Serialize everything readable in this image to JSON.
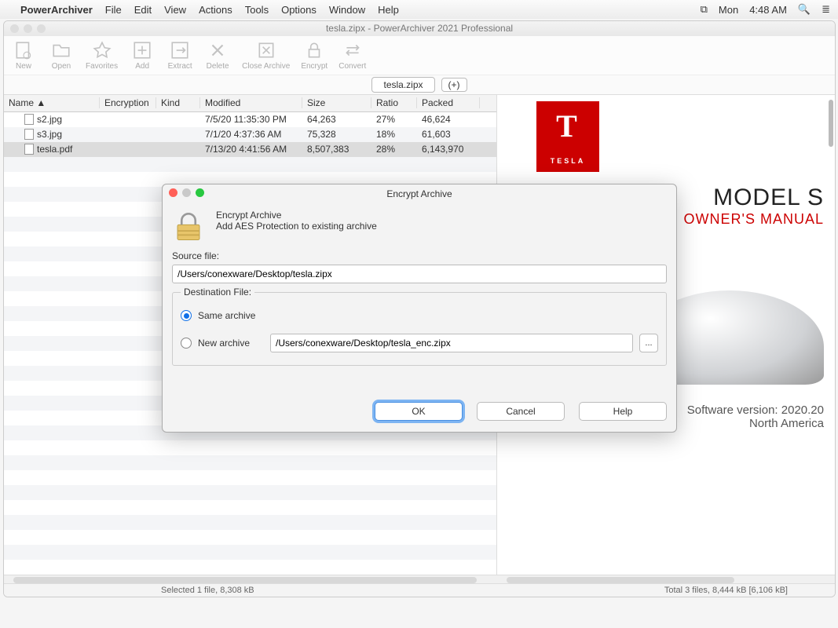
{
  "menubar": {
    "app": "PowerArchiver",
    "items": [
      "File",
      "Edit",
      "View",
      "Actions",
      "Tools",
      "Options",
      "Window",
      "Help"
    ],
    "clock_day": "Mon",
    "clock_time": "4:48 AM"
  },
  "window": {
    "title": "tesla.zipx - PowerArchiver 2021 Professional",
    "toolbar": [
      {
        "name": "new",
        "label": "New"
      },
      {
        "name": "open",
        "label": "Open"
      },
      {
        "name": "favorites",
        "label": "Favorites"
      },
      {
        "name": "add",
        "label": "Add"
      },
      {
        "name": "extract",
        "label": "Extract"
      },
      {
        "name": "delete",
        "label": "Delete"
      },
      {
        "name": "close-archive",
        "label": "Close Archive"
      },
      {
        "name": "encrypt",
        "label": "Encrypt"
      },
      {
        "name": "convert",
        "label": "Convert"
      }
    ],
    "tab_label": "tesla.zipx",
    "tab_plus": "(+)",
    "columns": {
      "name": "Name  ▲",
      "encryption": "Encryption",
      "kind": "Kind",
      "modified": "Modified",
      "size": "Size",
      "ratio": "Ratio",
      "packed": "Packed"
    },
    "rows": [
      {
        "name": "s2.jpg",
        "modified": "7/5/20 11:35:30 PM",
        "size": "64,263",
        "ratio": "27%",
        "packed": "46,624",
        "sel": false
      },
      {
        "name": "s3.jpg",
        "modified": "7/1/20 4:37:36 AM",
        "size": "75,328",
        "ratio": "18%",
        "packed": "61,603",
        "sel": false
      },
      {
        "name": "tesla.pdf",
        "modified": "7/13/20 4:41:56 AM",
        "size": "8,507,383",
        "ratio": "28%",
        "packed": "6,143,970",
        "sel": true
      }
    ],
    "status_left": "Selected 1 file, 8,308 kB",
    "status_right": "Total 3 files, 8,444 kB [6,106 kB]"
  },
  "preview": {
    "logo_text": "TESLA",
    "title": "MODEL S",
    "subtitle": "OWNER'S MANUAL",
    "sw1": "Software version: 2020.20",
    "sw2": "North America"
  },
  "dialog": {
    "title": "Encrypt Archive",
    "head_title": "Encrypt Archive",
    "head_sub": "Add AES Protection to existing archive",
    "source_label": "Source file:",
    "source_value": "/Users/conexware/Desktop/tesla.zipx",
    "dest_legend": "Destination File:",
    "opt_same": "Same archive",
    "opt_new": "New archive",
    "new_value": "/Users/conexware/Desktop/tesla_enc.zipx",
    "browse": "...",
    "ok": "OK",
    "cancel": "Cancel",
    "help": "Help"
  }
}
